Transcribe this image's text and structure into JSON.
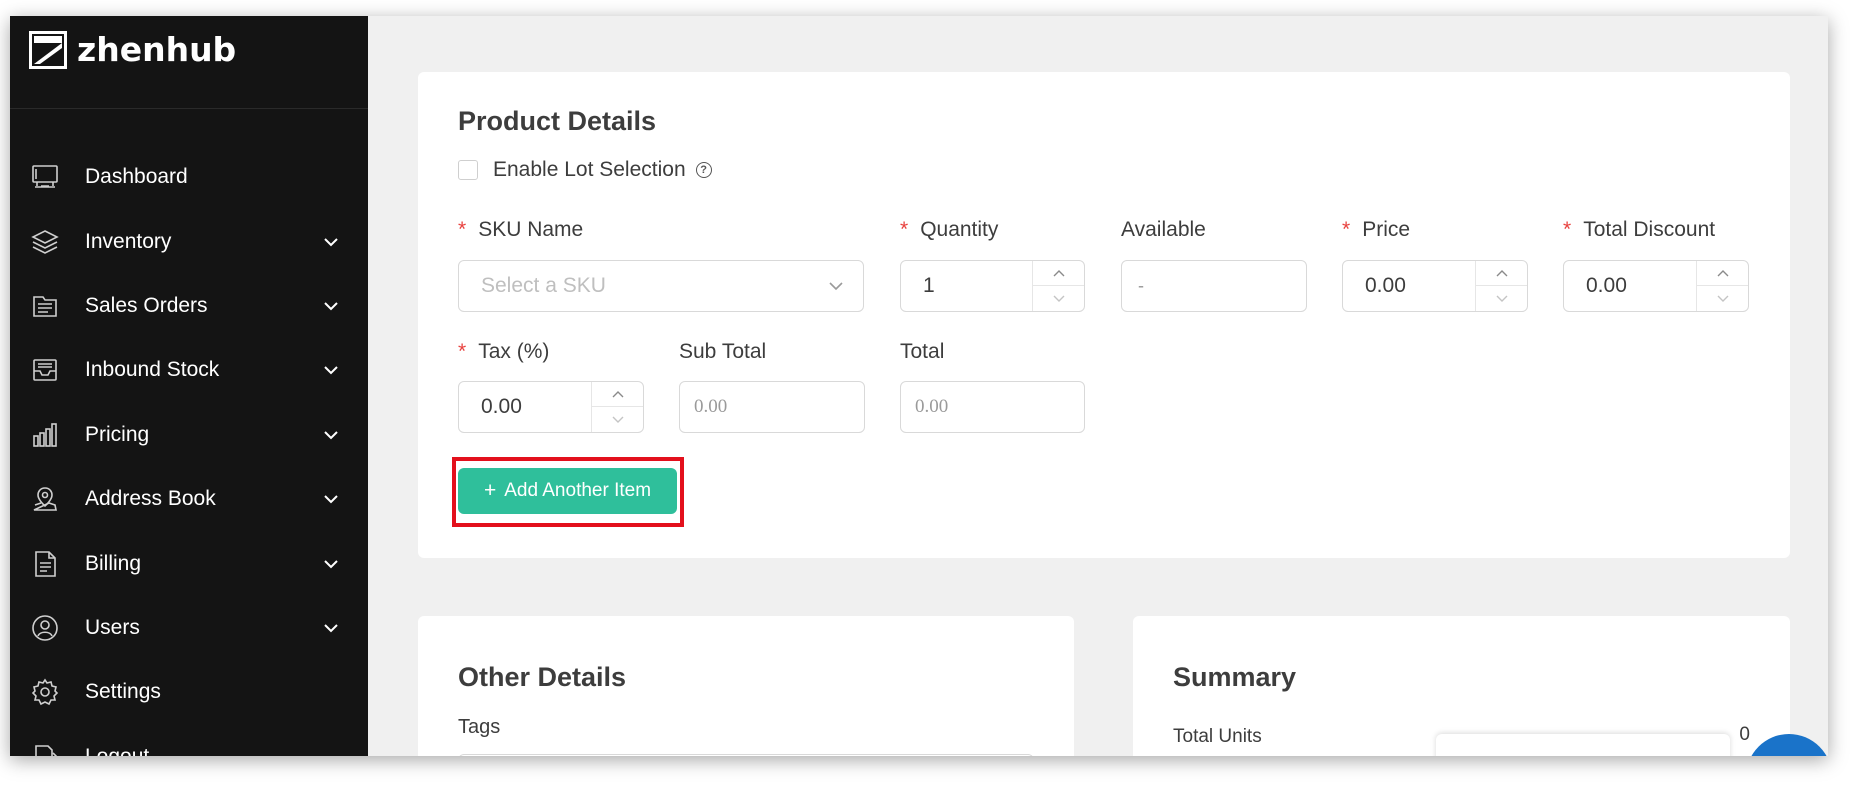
{
  "brand": {
    "name": "zhenhub"
  },
  "sidebar": {
    "items": [
      {
        "label": "Dashboard",
        "icon": "monitor-icon",
        "has_chevron": false
      },
      {
        "label": "Inventory",
        "icon": "layers-icon",
        "has_chevron": true
      },
      {
        "label": "Sales Orders",
        "icon": "folder-icon",
        "has_chevron": true
      },
      {
        "label": "Inbound Stock",
        "icon": "inbox-icon",
        "has_chevron": true
      },
      {
        "label": "Pricing",
        "icon": "bar-chart-icon",
        "has_chevron": true
      },
      {
        "label": "Address Book",
        "icon": "map-pin-icon",
        "has_chevron": true
      },
      {
        "label": "Billing",
        "icon": "document-icon",
        "has_chevron": true
      },
      {
        "label": "Users",
        "icon": "user-icon",
        "has_chevron": true
      },
      {
        "label": "Settings",
        "icon": "gear-icon",
        "has_chevron": false
      },
      {
        "label": "Logout",
        "icon": "logout-icon",
        "has_chevron": false
      }
    ]
  },
  "product_details": {
    "title": "Product Details",
    "lot_selection_label": "Enable Lot Selection",
    "help_glyph": "?",
    "required_mark": "*",
    "sku": {
      "label": "SKU Name",
      "placeholder": "Select a SKU"
    },
    "quantity": {
      "label": "Quantity",
      "value": "1"
    },
    "available": {
      "label": "Available",
      "value": "-"
    },
    "price": {
      "label": "Price",
      "value": "0.00"
    },
    "total_discount": {
      "label": "Total Discount",
      "value": "0.00"
    },
    "tax": {
      "label": "Tax (%)",
      "value": "0.00"
    },
    "sub_total": {
      "label": "Sub Total",
      "value": "0.00"
    },
    "total": {
      "label": "Total",
      "value": "0.00"
    },
    "add_button": {
      "icon": "+",
      "label": "Add Another Item"
    }
  },
  "other_details": {
    "title": "Other Details",
    "tags_label": "Tags"
  },
  "summary": {
    "title": "Summary",
    "total_units_label": "Total Units",
    "total_units_value": "0"
  },
  "colors": {
    "sidebar_bg": "#141414",
    "accent": "#2fbf9b",
    "required": "#e8423f",
    "highlight": "#e3101c"
  }
}
